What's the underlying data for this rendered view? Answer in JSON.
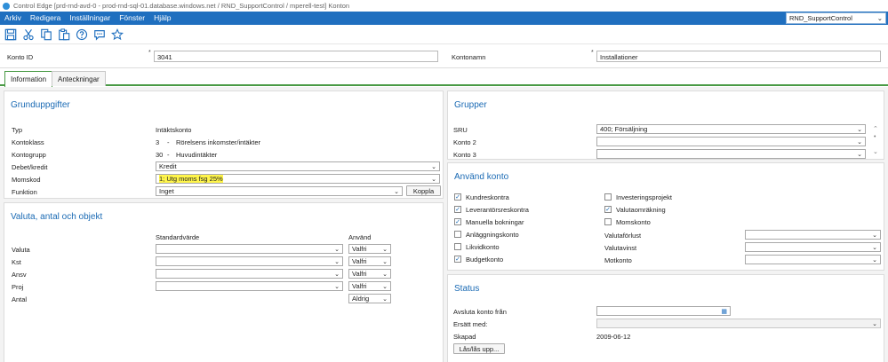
{
  "window": {
    "title": "Control Edge [prd-rnd-avd-0 - prod-rnd-sql-01.database.windows.net / RND_SupportControl / mperell-test] Konton"
  },
  "menu": {
    "items": [
      "Arkiv",
      "Redigera",
      "Inställningar",
      "Fönster",
      "Hjälp"
    ],
    "database": "RND_SupportControl"
  },
  "toolbar": {
    "icons": [
      "save-icon",
      "cut-icon",
      "copy-icon",
      "paste-icon",
      "help-icon",
      "comment-icon",
      "favorite-star-icon"
    ]
  },
  "header": {
    "konto_id_label": "Konto ID",
    "konto_id_required": "*",
    "konto_id_value": "3041",
    "kontonamn_label": "Kontonamn",
    "kontonamn_required": "*",
    "kontonamn_value": "Installationer"
  },
  "tabs": [
    {
      "label": "Information",
      "active": true
    },
    {
      "label": "Anteckningar",
      "active": false
    }
  ],
  "grunduppgifter": {
    "title": "Grunduppgifter",
    "typ_label": "Typ",
    "typ_value": "Intäktskonto",
    "kontoklass_label": "Kontoklass",
    "kontoklass_code": "3",
    "kontoklass_sep": "-",
    "kontoklass_value": "Rörelsens inkomster/intäkter",
    "kontogrupp_label": "Kontogrupp",
    "kontogrupp_code": "30",
    "kontogrupp_sep": "-",
    "kontogrupp_value": "Huvudintäkter",
    "debet_label": "Debet/kredit",
    "debet_value": "Kredit",
    "momskod_label": "Momskod",
    "momskod_value": "1; Utg moms fsg 25%",
    "funktion_label": "Funktion",
    "funktion_value": "Inget",
    "koppla_button": "Koppla",
    "highlight_color": "#fff54a"
  },
  "valuta": {
    "title": "Valuta, antal och objekt",
    "col_standard": "Standardvärde",
    "col_anvand": "Använd",
    "rows": [
      {
        "label": "Valuta",
        "standard": "",
        "anvand": "Valfri"
      },
      {
        "label": "Kst",
        "standard": "",
        "anvand": "Valfri"
      },
      {
        "label": "Ansv",
        "standard": "",
        "anvand": "Valfri"
      },
      {
        "label": "Proj",
        "standard": "",
        "anvand": "Valfri"
      }
    ],
    "antal_label": "Antal",
    "antal_value": "Aldrig"
  },
  "grupper": {
    "title": "Grupper",
    "sru_label": "SRU",
    "sru_value": "400; Försäljning",
    "konto2_label": "Konto 2",
    "konto2_value": "",
    "konto3_label": "Konto 3",
    "konto3_value": ""
  },
  "anvand_konto": {
    "title": "Använd konto",
    "left": [
      {
        "label": "Kundreskontra",
        "checked": true
      },
      {
        "label": "Leverantörsreskontra",
        "checked": true
      },
      {
        "label": "Manuella bokningar",
        "checked": true
      },
      {
        "label": "Anläggningskonto",
        "checked": false
      },
      {
        "label": "Likvidkonto",
        "checked": false
      },
      {
        "label": "Budgetkonto",
        "checked": true
      }
    ],
    "right": [
      {
        "label": "Investeringsprojekt",
        "checked": false
      },
      {
        "label": "Valutaomräkning",
        "checked": true
      },
      {
        "label": "Momskonto",
        "checked": false
      }
    ],
    "valutaforlust_label": "Valutaförlust",
    "valutavinst_label": "Valutavinst",
    "motkonto_label": "Motkonto"
  },
  "status": {
    "title": "Status",
    "avsluta_label": "Avsluta konto från",
    "avsluta_value": "",
    "ersatt_label": "Ersätt med:",
    "ersatt_value": "",
    "skapad_label": "Skapad",
    "skapad_value": "2009-06-12",
    "las_button": "Lås/lås upp..."
  }
}
